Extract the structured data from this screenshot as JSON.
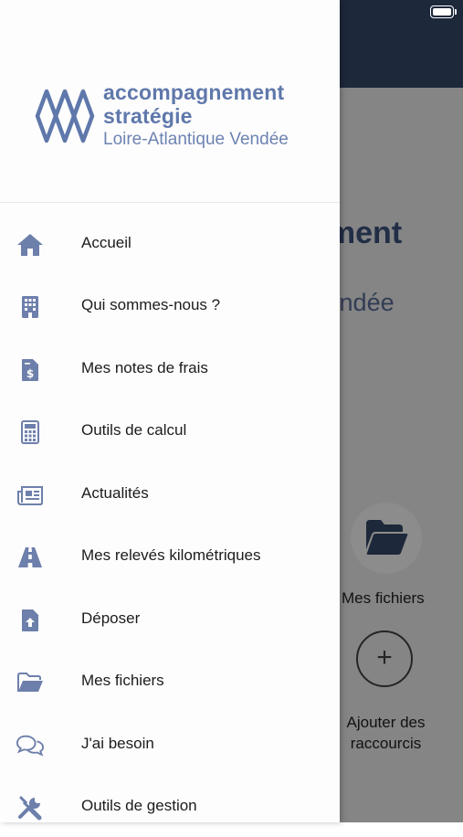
{
  "background": {
    "title_line1": "ement",
    "title_line2": "Vendée",
    "shortcuts": [
      {
        "label": "Mes fichiers",
        "icon": "folder-open-icon"
      },
      {
        "label": "Ajouter des raccourcis",
        "icon": "plus-icon",
        "plus_glyph": "+"
      }
    ]
  },
  "drawer": {
    "logo": {
      "line1": "accompagnement",
      "line2": "stratégie",
      "line3": "Loire-Atlantique Vendée"
    },
    "menu": [
      {
        "label": "Accueil",
        "icon": "home-icon"
      },
      {
        "label": "Qui sommes-nous ?",
        "icon": "building-icon"
      },
      {
        "label": "Mes notes de frais",
        "icon": "invoice-dollar-icon"
      },
      {
        "label": "Outils de calcul",
        "icon": "calculator-icon"
      },
      {
        "label": "Actualités",
        "icon": "newspaper-icon"
      },
      {
        "label": "Mes relevés kilométriques",
        "icon": "road-icon"
      },
      {
        "label": "Déposer",
        "icon": "file-upload-icon"
      },
      {
        "label": "Mes fichiers",
        "icon": "folder-open-icon"
      },
      {
        "label": "J'ai besoin",
        "icon": "chat-bubbles-icon"
      },
      {
        "label": "Outils de gestion",
        "icon": "tools-icon"
      }
    ]
  },
  "colors": {
    "icon": "#6d7fab",
    "brand": "#5f78ab",
    "header_bg": "#364a6b"
  }
}
